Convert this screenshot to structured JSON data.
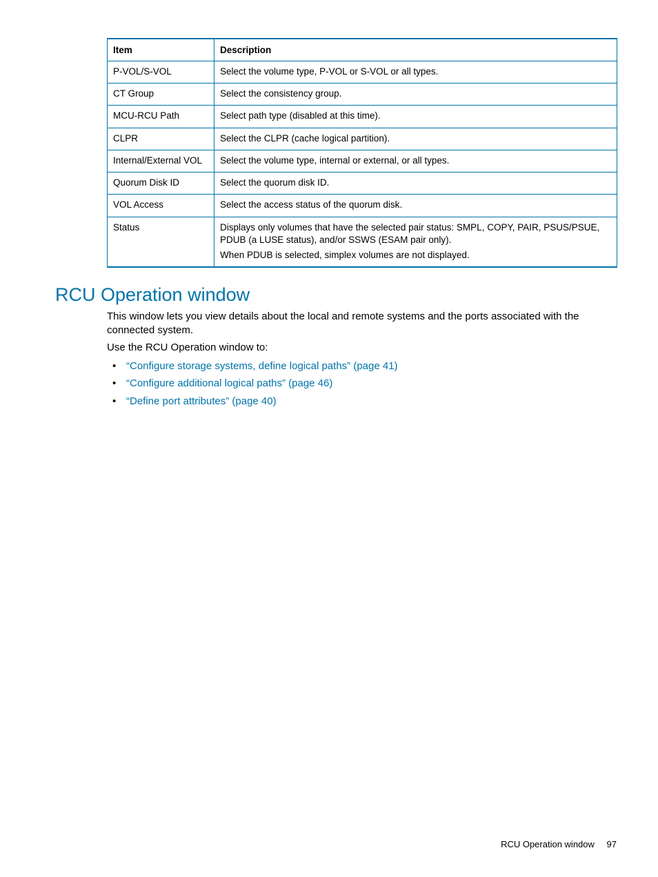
{
  "table": {
    "headers": {
      "item": "Item",
      "desc": "Description"
    },
    "rows": [
      {
        "item": "P-VOL/S-VOL",
        "desc": "Select the volume type, P-VOL or S-VOL or all types."
      },
      {
        "item": "CT Group",
        "desc": "Select the consistency group."
      },
      {
        "item": "MCU-RCU Path",
        "desc": "Select path type (disabled at this time)."
      },
      {
        "item": "CLPR",
        "desc": "Select the CLPR (cache logical partition)."
      },
      {
        "item": "Internal/External VOL",
        "desc": "Select the volume type, internal or external, or all types."
      },
      {
        "item": "Quorum Disk ID",
        "desc": "Select the quorum disk ID."
      },
      {
        "item": "VOL Access",
        "desc": "Select the access status of the quorum disk."
      }
    ],
    "status_row": {
      "item": "Status",
      "p1": "Displays only volumes that have the selected pair status: SMPL, COPY, PAIR, PSUS/PSUE, PDUB (a LUSE status), and/or SSWS (ESAM pair only).",
      "p2": "When PDUB is selected, simplex volumes are not displayed."
    }
  },
  "section": {
    "heading": "RCU Operation window",
    "p1": "This window lets you view details about the local and remote systems and the ports associated with the connected system.",
    "p2": "Use the RCU Operation window to:",
    "links": [
      "“Configure storage systems, define logical paths” (page 41)",
      "“Configure additional logical paths” (page 46)",
      "“Define port attributes” (page 40)"
    ]
  },
  "footer": {
    "title": "RCU Operation window",
    "page": "97"
  }
}
